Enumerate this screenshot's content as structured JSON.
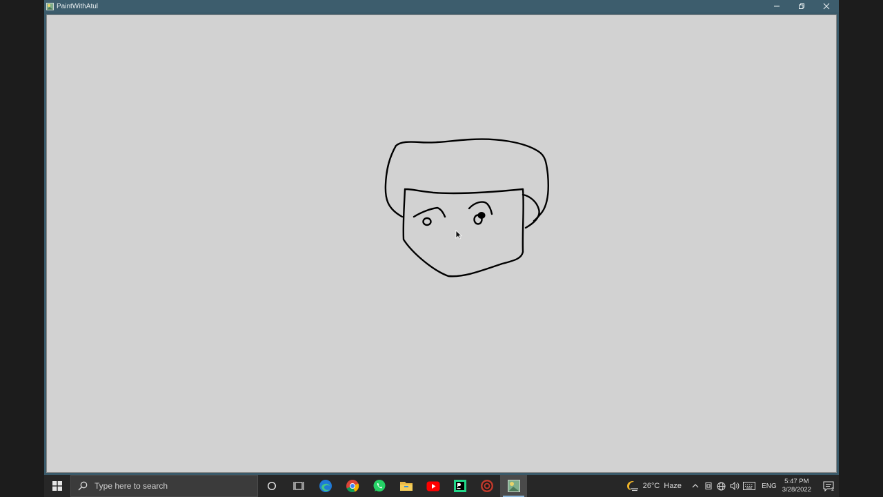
{
  "window": {
    "title": "PaintWithAtul"
  },
  "colors": {
    "titlebar": "#3d5d6d",
    "canvas": "#d2d2d2",
    "stroke": "#000000",
    "taskbar": "#272727"
  },
  "taskbar": {
    "search": {
      "placeholder": "Type here to search"
    },
    "pinned": [
      {
        "name": "cortana-icon"
      },
      {
        "name": "task-view-icon"
      },
      {
        "name": "edge-icon"
      },
      {
        "name": "chrome-icon"
      },
      {
        "name": "whatsapp-icon"
      },
      {
        "name": "file-explorer-icon"
      },
      {
        "name": "youtube-icon"
      },
      {
        "name": "pycharm-icon"
      },
      {
        "name": "recorder-icon"
      },
      {
        "name": "paint-app-icon"
      }
    ],
    "weather": {
      "temp": "26°C",
      "condition": "Haze"
    },
    "language": "ENG",
    "clock": {
      "time": "5:47 PM",
      "date": "3/28/2022"
    },
    "notifications": {
      "count": "2"
    }
  }
}
